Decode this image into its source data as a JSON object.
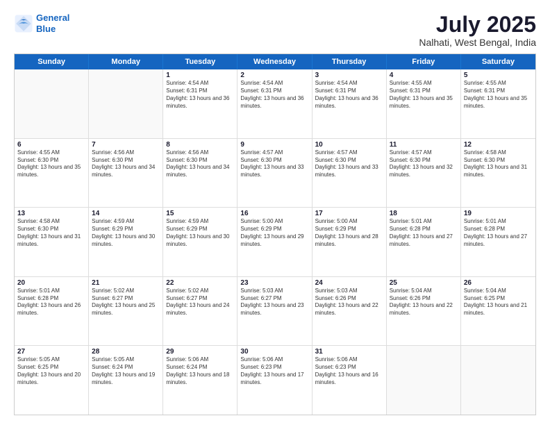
{
  "logo": {
    "line1": "General",
    "line2": "Blue"
  },
  "title": "July 2025",
  "subtitle": "Nalhati, West Bengal, India",
  "header": {
    "days": [
      "Sunday",
      "Monday",
      "Tuesday",
      "Wednesday",
      "Thursday",
      "Friday",
      "Saturday"
    ]
  },
  "rows": [
    [
      {
        "day": "",
        "empty": true
      },
      {
        "day": "",
        "empty": true
      },
      {
        "day": "1",
        "sunrise": "4:54 AM",
        "sunset": "6:31 PM",
        "daylight": "13 hours and 36 minutes."
      },
      {
        "day": "2",
        "sunrise": "4:54 AM",
        "sunset": "6:31 PM",
        "daylight": "13 hours and 36 minutes."
      },
      {
        "day": "3",
        "sunrise": "4:54 AM",
        "sunset": "6:31 PM",
        "daylight": "13 hours and 36 minutes."
      },
      {
        "day": "4",
        "sunrise": "4:55 AM",
        "sunset": "6:31 PM",
        "daylight": "13 hours and 35 minutes."
      },
      {
        "day": "5",
        "sunrise": "4:55 AM",
        "sunset": "6:31 PM",
        "daylight": "13 hours and 35 minutes."
      }
    ],
    [
      {
        "day": "6",
        "sunrise": "4:55 AM",
        "sunset": "6:30 PM",
        "daylight": "13 hours and 35 minutes."
      },
      {
        "day": "7",
        "sunrise": "4:56 AM",
        "sunset": "6:30 PM",
        "daylight": "13 hours and 34 minutes."
      },
      {
        "day": "8",
        "sunrise": "4:56 AM",
        "sunset": "6:30 PM",
        "daylight": "13 hours and 34 minutes."
      },
      {
        "day": "9",
        "sunrise": "4:57 AM",
        "sunset": "6:30 PM",
        "daylight": "13 hours and 33 minutes."
      },
      {
        "day": "10",
        "sunrise": "4:57 AM",
        "sunset": "6:30 PM",
        "daylight": "13 hours and 33 minutes."
      },
      {
        "day": "11",
        "sunrise": "4:57 AM",
        "sunset": "6:30 PM",
        "daylight": "13 hours and 32 minutes."
      },
      {
        "day": "12",
        "sunrise": "4:58 AM",
        "sunset": "6:30 PM",
        "daylight": "13 hours and 31 minutes."
      }
    ],
    [
      {
        "day": "13",
        "sunrise": "4:58 AM",
        "sunset": "6:30 PM",
        "daylight": "13 hours and 31 minutes."
      },
      {
        "day": "14",
        "sunrise": "4:59 AM",
        "sunset": "6:29 PM",
        "daylight": "13 hours and 30 minutes."
      },
      {
        "day": "15",
        "sunrise": "4:59 AM",
        "sunset": "6:29 PM",
        "daylight": "13 hours and 30 minutes."
      },
      {
        "day": "16",
        "sunrise": "5:00 AM",
        "sunset": "6:29 PM",
        "daylight": "13 hours and 29 minutes."
      },
      {
        "day": "17",
        "sunrise": "5:00 AM",
        "sunset": "6:29 PM",
        "daylight": "13 hours and 28 minutes."
      },
      {
        "day": "18",
        "sunrise": "5:01 AM",
        "sunset": "6:28 PM",
        "daylight": "13 hours and 27 minutes."
      },
      {
        "day": "19",
        "sunrise": "5:01 AM",
        "sunset": "6:28 PM",
        "daylight": "13 hours and 27 minutes."
      }
    ],
    [
      {
        "day": "20",
        "sunrise": "5:01 AM",
        "sunset": "6:28 PM",
        "daylight": "13 hours and 26 minutes."
      },
      {
        "day": "21",
        "sunrise": "5:02 AM",
        "sunset": "6:27 PM",
        "daylight": "13 hours and 25 minutes."
      },
      {
        "day": "22",
        "sunrise": "5:02 AM",
        "sunset": "6:27 PM",
        "daylight": "13 hours and 24 minutes."
      },
      {
        "day": "23",
        "sunrise": "5:03 AM",
        "sunset": "6:27 PM",
        "daylight": "13 hours and 23 minutes."
      },
      {
        "day": "24",
        "sunrise": "5:03 AM",
        "sunset": "6:26 PM",
        "daylight": "13 hours and 22 minutes."
      },
      {
        "day": "25",
        "sunrise": "5:04 AM",
        "sunset": "6:26 PM",
        "daylight": "13 hours and 22 minutes."
      },
      {
        "day": "26",
        "sunrise": "5:04 AM",
        "sunset": "6:25 PM",
        "daylight": "13 hours and 21 minutes."
      }
    ],
    [
      {
        "day": "27",
        "sunrise": "5:05 AM",
        "sunset": "6:25 PM",
        "daylight": "13 hours and 20 minutes."
      },
      {
        "day": "28",
        "sunrise": "5:05 AM",
        "sunset": "6:24 PM",
        "daylight": "13 hours and 19 minutes."
      },
      {
        "day": "29",
        "sunrise": "5:06 AM",
        "sunset": "6:24 PM",
        "daylight": "13 hours and 18 minutes."
      },
      {
        "day": "30",
        "sunrise": "5:06 AM",
        "sunset": "6:23 PM",
        "daylight": "13 hours and 17 minutes."
      },
      {
        "day": "31",
        "sunrise": "5:06 AM",
        "sunset": "6:23 PM",
        "daylight": "13 hours and 16 minutes."
      },
      {
        "day": "",
        "empty": true
      },
      {
        "day": "",
        "empty": true
      }
    ]
  ]
}
